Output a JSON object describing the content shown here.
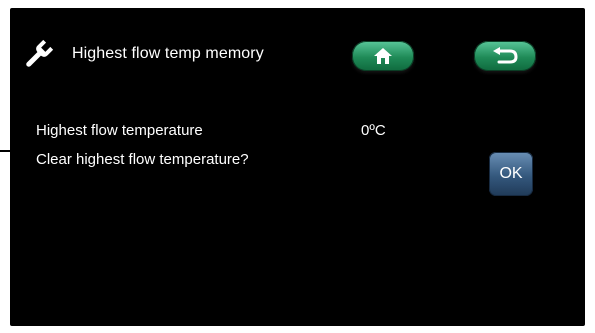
{
  "header": {
    "title": "Highest flow temp memory",
    "wrench_icon": "wrench-icon",
    "home_icon": "home-icon",
    "back_icon": "back-arrow-icon"
  },
  "rows": [
    {
      "label": "Highest flow temperature",
      "value": "0ºC"
    },
    {
      "label": "Clear highest flow temperature?"
    }
  ],
  "buttons": {
    "ok_label": "OK"
  },
  "colors": {
    "screen_background": "#000000",
    "nav_button_green": "#1f8a57",
    "ok_button_blue": "#34587d",
    "text": "#ffffff"
  }
}
